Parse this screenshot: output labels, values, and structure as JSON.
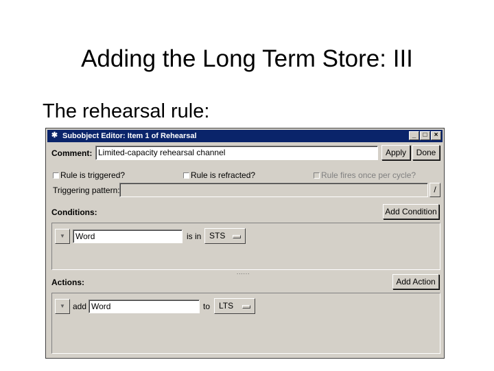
{
  "slide": {
    "title": "Adding the Long Term Store: III",
    "bullet": "The rehearsal rule:"
  },
  "window": {
    "title": "Subobject Editor: Item 1 of Rehearsal",
    "minimize_glyph": "_",
    "maximize_glyph": "□",
    "close_glyph": "×",
    "app_icon": "network-icon"
  },
  "comment": {
    "label": "Comment:",
    "value": "Limited-capacity rehearsal channel"
  },
  "buttons": {
    "apply": "Apply",
    "done": "Done",
    "add_condition": "Add Condition",
    "add_action": "Add Action"
  },
  "options": {
    "triggered": "Rule is triggered?",
    "refracted": "Rule is refracted?",
    "once_per_cycle": "Rule fires once per cycle?"
  },
  "triggering": {
    "label": "Triggering pattern:",
    "value": "",
    "edit_glyph": "/"
  },
  "conditions": {
    "label": "Conditions:",
    "items": [
      {
        "term": "Word",
        "relation": "is in",
        "buffer": "STS"
      }
    ]
  },
  "actions": {
    "label": "Actions:",
    "items": [
      {
        "verb": "add",
        "term": "Word",
        "preposition": "to",
        "buffer": "LTS"
      }
    ]
  },
  "sash_glyph": "......"
}
